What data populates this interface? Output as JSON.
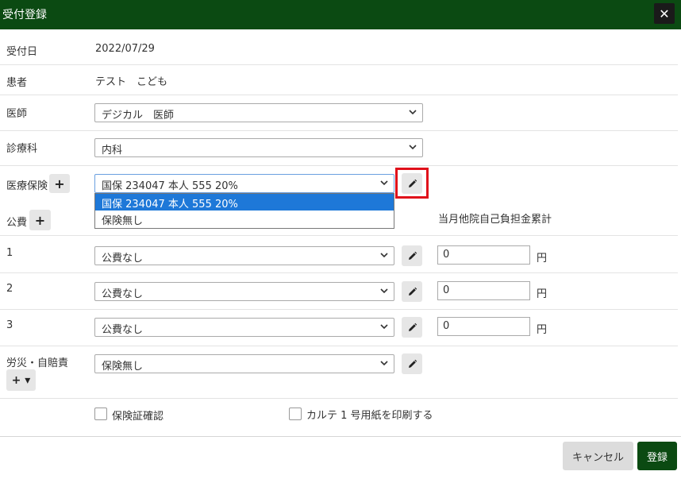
{
  "dialog": {
    "title": "受付登録",
    "close_label": "✕"
  },
  "form": {
    "reception_date_label": "受付日",
    "reception_date": "2022/07/29",
    "patient_label": "患者",
    "patient_name": "テスト　こども",
    "doctor_label": "医師",
    "doctor_value": "デジカル　医師",
    "department_label": "診療科",
    "department_value": "内科",
    "insurance_label": "医療保険",
    "insurance_value": "国保 234047 本人 555 20%",
    "insurance_options": [
      "国保 234047 本人 555 20%",
      "保険無し"
    ],
    "public_label": "公費",
    "monthly_total_label": "当月他院自己負担金累計",
    "public_rows": [
      {
        "index": "1",
        "value": "公費なし",
        "amount": "0",
        "unit": "円"
      },
      {
        "index": "2",
        "value": "公費なし",
        "amount": "0",
        "unit": "円"
      },
      {
        "index": "3",
        "value": "公費なし",
        "amount": "0",
        "unit": "円"
      }
    ],
    "accident_label": "労災・自賠責",
    "accident_value": "保険無し",
    "check_insurance_label": "保険証確認",
    "print_karte_label": "カルテ 1 号用紙を印刷する"
  },
  "buttons": {
    "cancel": "キャンセル",
    "register": "登録",
    "add": "+",
    "add_dropdown": "+ ▾"
  },
  "colors": {
    "header_bg": "#0b4a12",
    "register_bg": "#0b4a12",
    "highlight": "#e0101a",
    "option_selected": "#1e78d8"
  }
}
